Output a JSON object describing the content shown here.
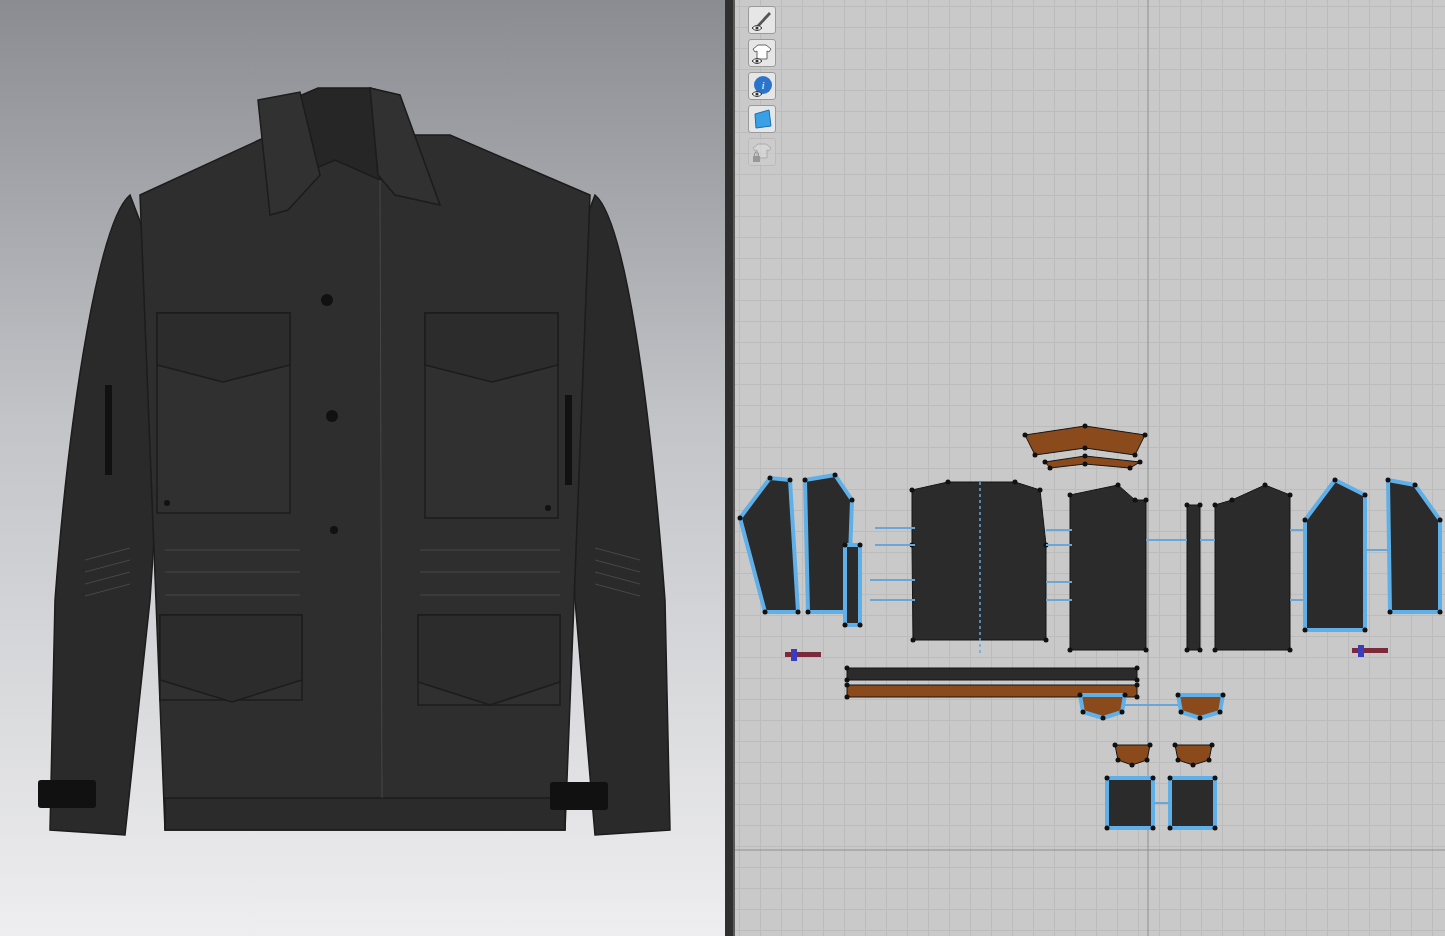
{
  "toolbar": [
    {
      "disabled": false
    },
    {
      "disabled": false
    },
    {
      "disabled": false
    },
    {
      "disabled": false
    },
    {
      "disabled": true
    }
  ],
  "pattern_pieces": [
    {
      "selected": true,
      "color": "#2b2b2b"
    },
    {
      "selected": true,
      "color": "#2b2b2b"
    },
    {
      "selected": true,
      "color": "#2b2b2b"
    },
    {
      "selected": false,
      "color": "#2b2b2b"
    },
    {
      "selected": false,
      "color": "#2b2b2b"
    },
    {
      "selected": false,
      "color": "#2b2b2b"
    },
    {
      "selected": false,
      "color": "#2b2b2b"
    },
    {
      "selected": true,
      "color": "#2b2b2b"
    },
    {
      "selected": true,
      "color": "#2b2b2b"
    },
    {
      "selected": false,
      "color": "#8a4a1c"
    },
    {
      "selected": false,
      "color": "#8a4a1c"
    },
    {
      "selected": false,
      "color": "#2b2b2b"
    },
    {
      "selected": false,
      "color": "#8a4a1c"
    },
    {
      "selected": true,
      "color": "#8a4a1c"
    },
    {
      "selected": true,
      "color": "#8a4a1c"
    },
    {
      "selected": false,
      "color": "#8a4a1c"
    },
    {
      "selected": false,
      "color": "#8a4a1c"
    },
    {
      "selected": true,
      "color": "#2b2b2b"
    },
    {
      "selected": true,
      "color": "#2b2b2b"
    }
  ]
}
